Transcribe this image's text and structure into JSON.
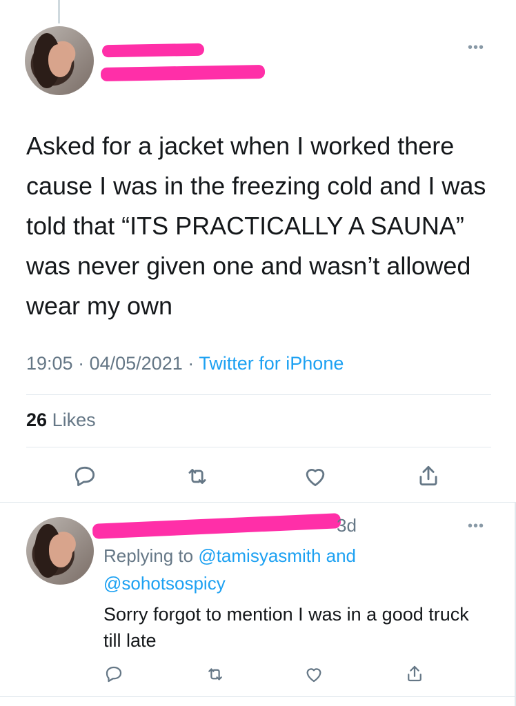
{
  "tweet": {
    "text": "Asked for a jacket when I worked there cause I was in the freezing cold and I was told that “ITS PRACTICALLY A SAUNA” was never given one and wasn’t allowed wear my own",
    "time": "19:05",
    "date": "04/05/2021",
    "source": "Twitter for iPhone",
    "likes_count": "26",
    "likes_label": "Likes",
    "more_label": "•••"
  },
  "reply": {
    "time_ago": "3d",
    "replying_prefix": "Replying to",
    "handle1": "@tamisyasmith",
    "and_word": "and",
    "handle2": "@sohotsospicy",
    "text": "Sorry forgot to mention I was in a good truck till late",
    "more_label": "•••"
  },
  "colors": {
    "link": "#1da1f2",
    "secondary": "#657786",
    "redaction": "#ff2fa8"
  },
  "icons": [
    "reply-icon",
    "retweet-icon",
    "like-icon",
    "share-icon"
  ]
}
